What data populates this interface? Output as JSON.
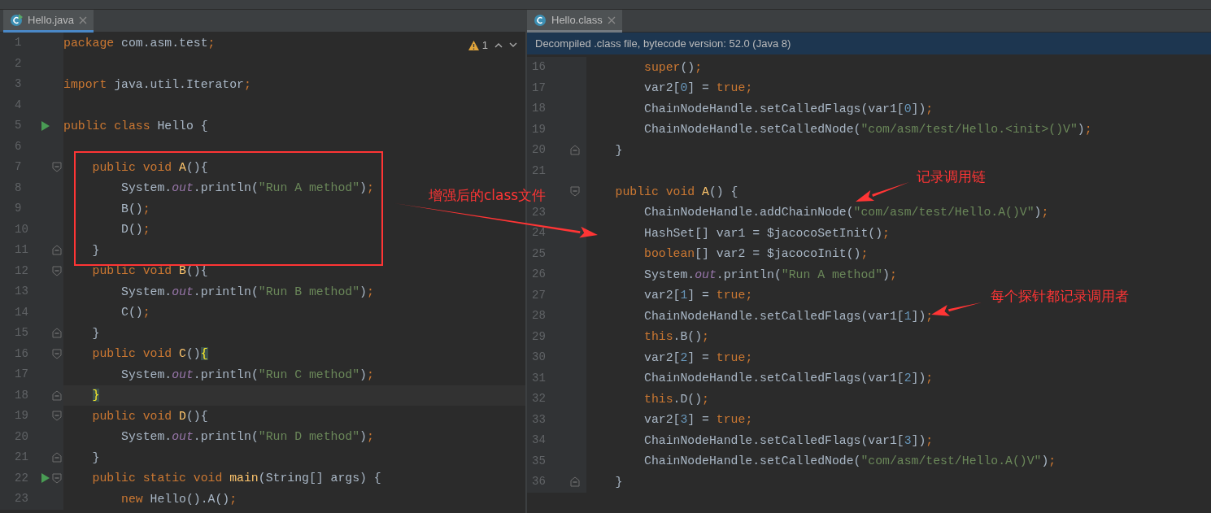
{
  "left_editor": {
    "tab": {
      "label": "Hello.java",
      "selected": true
    },
    "warnings": "1",
    "lines": [
      {
        "number": "1",
        "t": [
          {
            "kind": "keyword",
            "text": "package"
          },
          {
            "kind": "plain",
            "text": " com.asm.test"
          },
          {
            "kind": "punct",
            "text": ";"
          }
        ]
      },
      {
        "number": "2"
      },
      {
        "number": "3",
        "t": [
          {
            "kind": "keyword",
            "text": "import"
          },
          {
            "kind": "plain",
            "text": " java.util.Iterator"
          },
          {
            "kind": "punct",
            "text": ";"
          }
        ]
      },
      {
        "number": "4"
      },
      {
        "number": "5",
        "run": true,
        "t": [
          {
            "kind": "keyword",
            "text": "public class "
          },
          {
            "kind": "plain",
            "text": "Hello {"
          }
        ]
      },
      {
        "number": "6"
      },
      {
        "number": "7",
        "fold": {
          "kind": "open"
        },
        "t": [
          {
            "kind": "keyword",
            "text": "    public void "
          },
          {
            "kind": "method",
            "text": "A"
          },
          {
            "kind": "plain",
            "text": "(){"
          }
        ]
      },
      {
        "number": "8",
        "t": [
          {
            "kind": "plain",
            "text": "        System."
          },
          {
            "kind": "field",
            "text": "out"
          },
          {
            "kind": "plain",
            "text": ".println("
          },
          {
            "kind": "string",
            "text": "\"Run A method\""
          },
          {
            "kind": "plain",
            "text": ")"
          },
          {
            "kind": "punct",
            "text": ";"
          }
        ]
      },
      {
        "number": "9",
        "t": [
          {
            "kind": "plain",
            "text": "        B()"
          },
          {
            "kind": "punct",
            "text": ";"
          }
        ]
      },
      {
        "number": "10",
        "t": [
          {
            "kind": "plain",
            "text": "        D()"
          },
          {
            "kind": "punct",
            "text": ";"
          }
        ]
      },
      {
        "number": "11",
        "fold": {
          "kind": "close"
        },
        "t": [
          {
            "kind": "plain",
            "text": "    }"
          }
        ]
      },
      {
        "number": "12",
        "fold": {
          "kind": "open"
        },
        "t": [
          {
            "kind": "keyword",
            "text": "    public void "
          },
          {
            "kind": "method",
            "text": "B"
          },
          {
            "kind": "plain",
            "text": "(){"
          }
        ]
      },
      {
        "number": "13",
        "t": [
          {
            "kind": "plain",
            "text": "        System."
          },
          {
            "kind": "field",
            "text": "out"
          },
          {
            "kind": "plain",
            "text": ".println("
          },
          {
            "kind": "string",
            "text": "\"Run B method\""
          },
          {
            "kind": "plain",
            "text": ")"
          },
          {
            "kind": "punct",
            "text": ";"
          }
        ]
      },
      {
        "number": "14",
        "t": [
          {
            "kind": "plain",
            "text": "        C()"
          },
          {
            "kind": "punct",
            "text": ";"
          }
        ]
      },
      {
        "number": "15",
        "fold": {
          "kind": "close"
        },
        "t": [
          {
            "kind": "plain",
            "text": "    }"
          }
        ]
      },
      {
        "number": "16",
        "fold": {
          "kind": "open"
        },
        "t": [
          {
            "kind": "keyword",
            "text": "    public void "
          },
          {
            "kind": "method",
            "text": "C"
          },
          {
            "kind": "plain",
            "text": "()"
          },
          {
            "kind": "brace",
            "text": "{"
          }
        ]
      },
      {
        "number": "17",
        "t": [
          {
            "kind": "plain",
            "text": "        System."
          },
          {
            "kind": "field",
            "text": "out"
          },
          {
            "kind": "plain",
            "text": ".println("
          },
          {
            "kind": "string",
            "text": "\"Run C method\""
          },
          {
            "kind": "plain",
            "text": ")"
          },
          {
            "kind": "punct",
            "text": ";"
          }
        ]
      },
      {
        "number": "18",
        "current": true,
        "fold": {
          "kind": "close"
        },
        "t": [
          {
            "kind": "brace",
            "text": "    }"
          }
        ]
      },
      {
        "number": "19",
        "fold": {
          "kind": "open"
        },
        "t": [
          {
            "kind": "keyword",
            "text": "    public void "
          },
          {
            "kind": "method",
            "text": "D"
          },
          {
            "kind": "plain",
            "text": "(){"
          }
        ]
      },
      {
        "number": "20",
        "t": [
          {
            "kind": "plain",
            "text": "        System."
          },
          {
            "kind": "field",
            "text": "out"
          },
          {
            "kind": "plain",
            "text": ".println("
          },
          {
            "kind": "string",
            "text": "\"Run D method\""
          },
          {
            "kind": "plain",
            "text": ")"
          },
          {
            "kind": "punct",
            "text": ";"
          }
        ]
      },
      {
        "number": "21",
        "fold": {
          "kind": "close"
        },
        "t": [
          {
            "kind": "plain",
            "text": "    }"
          }
        ]
      },
      {
        "number": "22",
        "run": true,
        "fold": {
          "kind": "open"
        },
        "t": [
          {
            "kind": "keyword",
            "text": "    public static void "
          },
          {
            "kind": "method",
            "text": "main"
          },
          {
            "kind": "plain",
            "text": "(String[] args) {"
          }
        ]
      },
      {
        "number": "23",
        "t": [
          {
            "kind": "keyword",
            "text": "        new "
          },
          {
            "kind": "plain",
            "text": "Hello().A()"
          },
          {
            "kind": "punct",
            "text": ";"
          }
        ]
      }
    ]
  },
  "right_editor": {
    "tab": {
      "label": "Hello.class",
      "selected": true
    },
    "banner": "Decompiled .class file, bytecode version: 52.0 (Java 8)",
    "lines": [
      {
        "number": "16",
        "t": [
          {
            "kind": "keyword",
            "text": "        super"
          },
          {
            "kind": "plain",
            "text": "()"
          },
          {
            "kind": "punct",
            "text": ";"
          }
        ]
      },
      {
        "number": "17",
        "t": [
          {
            "kind": "plain",
            "text": "        var2["
          },
          {
            "kind": "number",
            "text": "0"
          },
          {
            "kind": "plain",
            "text": "] = "
          },
          {
            "kind": "keyword",
            "text": "true"
          },
          {
            "kind": "punct",
            "text": ";"
          }
        ]
      },
      {
        "number": "18",
        "t": [
          {
            "kind": "plain",
            "text": "        ChainNodeHandle.setCalledFlags(var1["
          },
          {
            "kind": "number",
            "text": "0"
          },
          {
            "kind": "plain",
            "text": "])"
          },
          {
            "kind": "punct",
            "text": ";"
          }
        ]
      },
      {
        "number": "19",
        "t": [
          {
            "kind": "plain",
            "text": "        ChainNodeHandle.setCalledNode("
          },
          {
            "kind": "string",
            "text": "\"com/asm/test/Hello.<init>()V\""
          },
          {
            "kind": "plain",
            "text": ")"
          },
          {
            "kind": "punct",
            "text": ";"
          }
        ]
      },
      {
        "number": "20",
        "fold": {
          "kind": "close"
        },
        "t": [
          {
            "kind": "plain",
            "text": "    }"
          }
        ]
      },
      {
        "number": "21"
      },
      {
        "fold": {
          "kind": "open"
        },
        "t": [
          {
            "kind": "keyword",
            "text": "    public void "
          },
          {
            "kind": "method",
            "text": "A"
          },
          {
            "kind": "plain",
            "text": "() {"
          }
        ]
      },
      {
        "number": "23",
        "t": [
          {
            "kind": "plain",
            "text": "        ChainNodeHandle.addChainNode("
          },
          {
            "kind": "string",
            "text": "\"com/asm/test/Hello.A()V\""
          },
          {
            "kind": "plain",
            "text": ")"
          },
          {
            "kind": "punct",
            "text": ";"
          }
        ]
      },
      {
        "number": "24",
        "t": [
          {
            "kind": "plain",
            "text": "        HashSet[] var1 = $jacocoSetInit()"
          },
          {
            "kind": "punct",
            "text": ";"
          }
        ]
      },
      {
        "number": "25",
        "t": [
          {
            "kind": "keyword",
            "text": "        boolean"
          },
          {
            "kind": "plain",
            "text": "[] var2 = $jacocoInit()"
          },
          {
            "kind": "punct",
            "text": ";"
          }
        ]
      },
      {
        "number": "26",
        "t": [
          {
            "kind": "plain",
            "text": "        System."
          },
          {
            "kind": "field",
            "text": "out"
          },
          {
            "kind": "plain",
            "text": ".println("
          },
          {
            "kind": "string",
            "text": "\"Run A method\""
          },
          {
            "kind": "plain",
            "text": ")"
          },
          {
            "kind": "punct",
            "text": ";"
          }
        ]
      },
      {
        "number": "27",
        "t": [
          {
            "kind": "plain",
            "text": "        var2["
          },
          {
            "kind": "number",
            "text": "1"
          },
          {
            "kind": "plain",
            "text": "] = "
          },
          {
            "kind": "keyword",
            "text": "true"
          },
          {
            "kind": "punct",
            "text": ";"
          }
        ]
      },
      {
        "number": "28",
        "t": [
          {
            "kind": "plain",
            "text": "        ChainNodeHandle.setCalledFlags(var1["
          },
          {
            "kind": "number",
            "text": "1"
          },
          {
            "kind": "plain",
            "text": "])"
          },
          {
            "kind": "punct",
            "text": ";"
          }
        ]
      },
      {
        "number": "29",
        "t": [
          {
            "kind": "keyword",
            "text": "        this"
          },
          {
            "kind": "plain",
            "text": ".B()"
          },
          {
            "kind": "punct",
            "text": ";"
          }
        ]
      },
      {
        "number": "30",
        "t": [
          {
            "kind": "plain",
            "text": "        var2["
          },
          {
            "kind": "number",
            "text": "2"
          },
          {
            "kind": "plain",
            "text": "] = "
          },
          {
            "kind": "keyword",
            "text": "true"
          },
          {
            "kind": "punct",
            "text": ";"
          }
        ]
      },
      {
        "number": "31",
        "t": [
          {
            "kind": "plain",
            "text": "        ChainNodeHandle.setCalledFlags(var1["
          },
          {
            "kind": "number",
            "text": "2"
          },
          {
            "kind": "plain",
            "text": "])"
          },
          {
            "kind": "punct",
            "text": ";"
          }
        ]
      },
      {
        "number": "32",
        "t": [
          {
            "kind": "keyword",
            "text": "        this"
          },
          {
            "kind": "plain",
            "text": ".D()"
          },
          {
            "kind": "punct",
            "text": ";"
          }
        ]
      },
      {
        "number": "33",
        "t": [
          {
            "kind": "plain",
            "text": "        var2["
          },
          {
            "kind": "number",
            "text": "3"
          },
          {
            "kind": "plain",
            "text": "] = "
          },
          {
            "kind": "keyword",
            "text": "true"
          },
          {
            "kind": "punct",
            "text": ";"
          }
        ]
      },
      {
        "number": "34",
        "t": [
          {
            "kind": "plain",
            "text": "        ChainNodeHandle.setCalledFlags(var1["
          },
          {
            "kind": "number",
            "text": "3"
          },
          {
            "kind": "plain",
            "text": "])"
          },
          {
            "kind": "punct",
            "text": ";"
          }
        ]
      },
      {
        "number": "35",
        "t": [
          {
            "kind": "plain",
            "text": "        ChainNodeHandle.setCalledNode("
          },
          {
            "kind": "string",
            "text": "\"com/asm/test/Hello.A()V\""
          },
          {
            "kind": "plain",
            "text": ")"
          },
          {
            "kind": "punct",
            "text": ";"
          }
        ]
      },
      {
        "number": "36",
        "fold": {
          "kind": "close"
        },
        "t": [
          {
            "kind": "plain",
            "text": "    }"
          }
        ]
      }
    ]
  },
  "callouts": [
    {
      "text": "增强后的class文件"
    },
    {
      "text": "记录调用链"
    },
    {
      "text": "每个探针都记录调用者"
    }
  ]
}
